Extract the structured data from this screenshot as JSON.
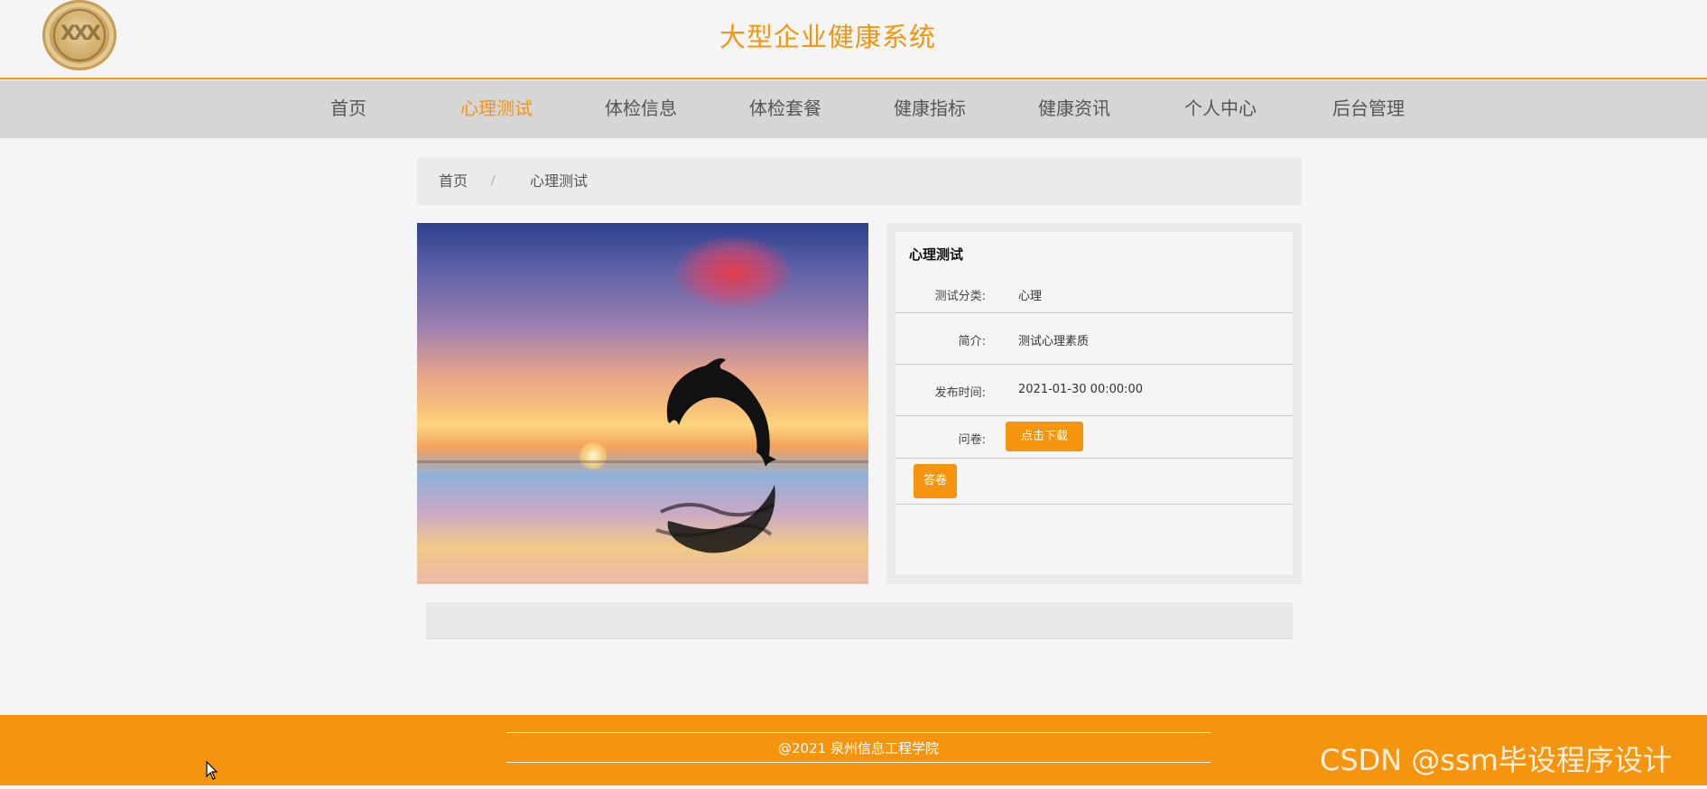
{
  "header": {
    "title": "大型企业健康系统",
    "logo_icon": "school-seal-logo"
  },
  "nav": {
    "items": [
      {
        "label": "首页",
        "active": false
      },
      {
        "label": "心理测试",
        "active": true
      },
      {
        "label": "体检信息",
        "active": false
      },
      {
        "label": "体检套餐",
        "active": false
      },
      {
        "label": "健康指标",
        "active": false
      },
      {
        "label": "健康资讯",
        "active": false
      },
      {
        "label": "个人中心",
        "active": false
      },
      {
        "label": "后台管理",
        "active": false
      }
    ]
  },
  "breadcrumb": {
    "home": "首页",
    "separator": "/",
    "current": "心理测试"
  },
  "detail": {
    "title": "心理测试",
    "fields": [
      {
        "label": "测试分类:",
        "value": "心理"
      },
      {
        "label": "简介:",
        "value": "测试心理素质"
      },
      {
        "label": "发布时间:",
        "value": "2021-01-30 00:00:00"
      }
    ],
    "questionnaire_label": "问卷:",
    "download_button": "点击下载",
    "answer_button": "答卷"
  },
  "footer": {
    "copyright": "@2021 泉州信息工程学院"
  },
  "watermark": "CSDN @ssm毕设程序设计",
  "colors": {
    "accent": "#f5950f",
    "nav_bg": "#d6d6d6",
    "page_bg": "#f5f5f5"
  }
}
